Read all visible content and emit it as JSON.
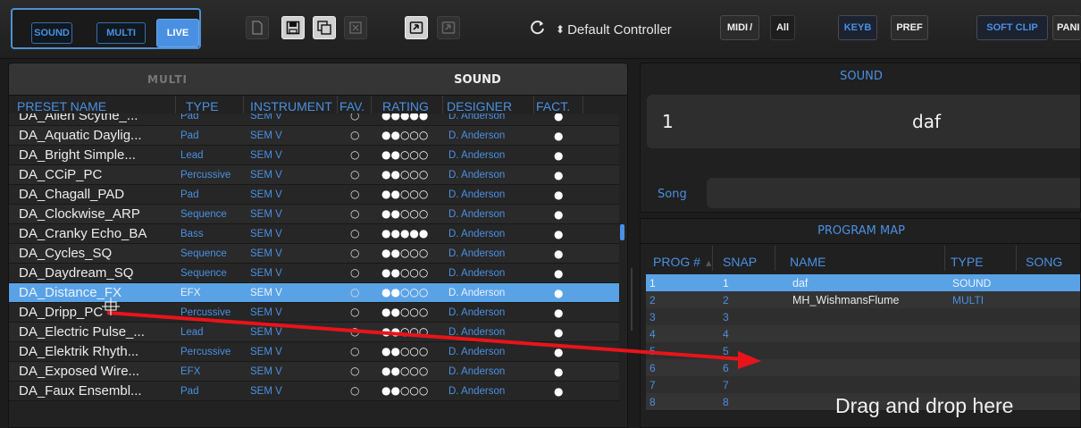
{
  "toolbar": {
    "modes": {
      "sound": "SOUND",
      "multi": "MULTI",
      "live": "LIVE"
    },
    "controller": "Default Controller",
    "midi": "MIDI",
    "all": "All",
    "keyb": "KEYB",
    "pref": "PREF",
    "soft_clip": "SOFT CLIP",
    "panic": "PANI"
  },
  "browser": {
    "header_multi": "MULTI",
    "header_sound": "SOUND",
    "columns": [
      "PRESET NAME",
      "TYPE",
      "INSTRUMENT",
      "FAV.",
      "RATING",
      "DESIGNER",
      "FACT."
    ],
    "rows": [
      {
        "name": "DA_Alien Scythe_...",
        "type": "Pad",
        "inst": "SEM V",
        "fav": "○",
        "rating": "●●●●●",
        "designer": "D. Anderson",
        "fact": "●"
      },
      {
        "name": "DA_Aquatic Daylig...",
        "type": "Pad",
        "inst": "SEM V",
        "fav": "○",
        "rating": "●●○○○",
        "designer": "D. Anderson",
        "fact": "●"
      },
      {
        "name": "DA_Bright Simple...",
        "type": "Lead",
        "inst": "SEM V",
        "fav": "○",
        "rating": "●●○○○",
        "designer": "D. Anderson",
        "fact": "●"
      },
      {
        "name": "DA_CCiP_PC",
        "type": "Percussive",
        "inst": "SEM V",
        "fav": "○",
        "rating": "●●○○○",
        "designer": "D. Anderson",
        "fact": "●"
      },
      {
        "name": "DA_Chagall_PAD",
        "type": "Pad",
        "inst": "SEM V",
        "fav": "○",
        "rating": "●●○○○",
        "designer": "D. Anderson",
        "fact": "●"
      },
      {
        "name": "DA_Clockwise_ARP",
        "type": "Sequence",
        "inst": "SEM V",
        "fav": "○",
        "rating": "●●○○○",
        "designer": "D. Anderson",
        "fact": "●"
      },
      {
        "name": "DA_Cranky Echo_BA",
        "type": "Bass",
        "inst": "SEM V",
        "fav": "○",
        "rating": "●●●●●",
        "designer": "D. Anderson",
        "fact": "●"
      },
      {
        "name": "DA_Cycles_SQ",
        "type": "Sequence",
        "inst": "SEM V",
        "fav": "○",
        "rating": "●●○○○",
        "designer": "D. Anderson",
        "fact": "●"
      },
      {
        "name": "DA_Daydream_SQ",
        "type": "Sequence",
        "inst": "SEM V",
        "fav": "○",
        "rating": "●●○○○",
        "designer": "D. Anderson",
        "fact": "●"
      },
      {
        "name": "DA_Distance_FX",
        "type": "EFX",
        "inst": "SEM V",
        "fav": "○",
        "rating": "●●○○○",
        "designer": "D. Anderson",
        "fact": "●",
        "selected": true
      },
      {
        "name": "DA_Dripp_PC",
        "type": "Percussive",
        "inst": "SEM V",
        "fav": "○",
        "rating": "●●○○○",
        "designer": "D. Anderson",
        "fact": "●"
      },
      {
        "name": "DA_Electric Pulse_...",
        "type": "Lead",
        "inst": "SEM V",
        "fav": "○",
        "rating": "●●○○○",
        "designer": "D. Anderson",
        "fact": "●"
      },
      {
        "name": "DA_Elektrik Rhyth...",
        "type": "Percussive",
        "inst": "SEM V",
        "fav": "○",
        "rating": "●●○○○",
        "designer": "D. Anderson",
        "fact": "●"
      },
      {
        "name": "DA_Exposed Wire...",
        "type": "EFX",
        "inst": "SEM V",
        "fav": "○",
        "rating": "●●○○○",
        "designer": "D. Anderson",
        "fact": "●"
      },
      {
        "name": "DA_Faux Ensembl...",
        "type": "Pad",
        "inst": "SEM V",
        "fav": "○",
        "rating": "●●○○○",
        "designer": "D. Anderson",
        "fact": "●"
      }
    ]
  },
  "sound_panel": {
    "title": "SOUND",
    "number": "1",
    "name": "daf",
    "song_label": "Song"
  },
  "program_map": {
    "title": "PROGRAM MAP",
    "columns": [
      "PROG #",
      "SNAP",
      "NAME",
      "TYPE",
      "SONG"
    ],
    "rows": [
      {
        "prog": "1",
        "snap": "1",
        "name": "daf",
        "type": "SOUND",
        "selected": true
      },
      {
        "prog": "2",
        "snap": "2",
        "name": "MH_WishmansFlume",
        "type": "MULTI"
      },
      {
        "prog": "3",
        "snap": "3",
        "name": "",
        "type": ""
      },
      {
        "prog": "4",
        "snap": "4",
        "name": "",
        "type": ""
      },
      {
        "prog": "5",
        "snap": "5",
        "name": "",
        "type": ""
      },
      {
        "prog": "6",
        "snap": "6",
        "name": "",
        "type": ""
      },
      {
        "prog": "7",
        "snap": "7",
        "name": "",
        "type": ""
      },
      {
        "prog": "8",
        "snap": "8",
        "name": "",
        "type": ""
      }
    ],
    "drop_hint": "Drag and drop here"
  },
  "colors": {
    "accent": "#4a90e2",
    "selected_row": "#5aa2e6",
    "arrow": "#e8141a"
  }
}
